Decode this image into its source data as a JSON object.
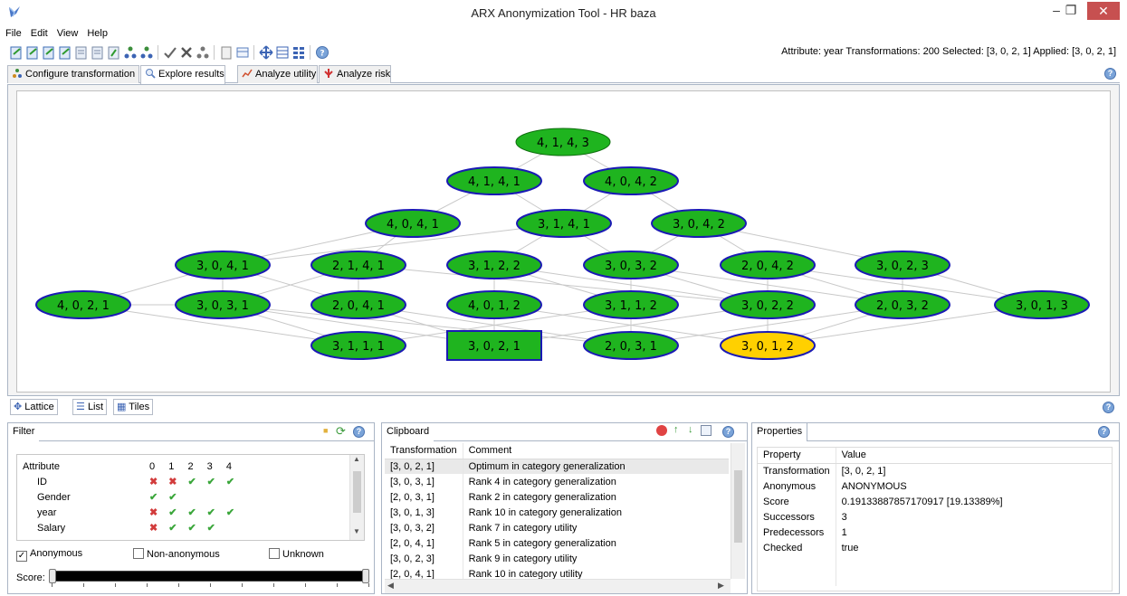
{
  "window": {
    "title": "ARX Anonymization Tool - HR baza",
    "min_label": "–",
    "max_label": "❐",
    "close_label": "✕"
  },
  "menu": [
    "File",
    "Edit",
    "View",
    "Help"
  ],
  "toolbar": {
    "status": "Attribute: year   Transformations: 200   Selected: [3, 0, 2, 1]   Applied: [3, 0, 2, 1]"
  },
  "tabs": [
    {
      "label": "Configure transformation",
      "icon": "configure-icon"
    },
    {
      "label": "Explore results",
      "icon": "magnifier-icon"
    },
    {
      "label": "Analyze utility",
      "icon": "chart-icon"
    },
    {
      "label": "Analyze risk",
      "icon": "risk-icon"
    }
  ],
  "lattice": {
    "colors": {
      "node": "#1fb41f",
      "node_border": "#1a1ab4",
      "applied": "#ffd000",
      "edge": "#c8c8c8"
    },
    "nodes": [
      {
        "label": "4, 1, 4, 3"
      },
      {
        "label": "4, 1, 4, 1"
      },
      {
        "label": "4, 0, 4, 2"
      },
      {
        "label": "4, 0, 4, 1"
      },
      {
        "label": "3, 1, 4, 1"
      },
      {
        "label": "3, 0, 4, 2"
      },
      {
        "label": "3, 0, 4, 1"
      },
      {
        "label": "2, 1, 4, 1"
      },
      {
        "label": "3, 1, 2, 2"
      },
      {
        "label": "3, 0, 3, 2"
      },
      {
        "label": "2, 0, 4, 2"
      },
      {
        "label": "3, 0, 2, 3"
      },
      {
        "label": "4, 0, 2, 1"
      },
      {
        "label": "3, 0, 3, 1"
      },
      {
        "label": "2, 0, 4, 1"
      },
      {
        "label": "4, 0, 1, 2"
      },
      {
        "label": "3, 1, 1, 2"
      },
      {
        "label": "3, 0, 2, 2"
      },
      {
        "label": "2, 0, 3, 2"
      },
      {
        "label": "3, 0, 1, 3"
      },
      {
        "label": "3, 1, 1, 1"
      },
      {
        "label": "3, 0, 2, 1"
      },
      {
        "label": "2, 0, 3, 1"
      },
      {
        "label": "3, 0, 1, 2"
      }
    ]
  },
  "view_tabs": [
    "Lattice",
    "List",
    "Tiles"
  ],
  "filter": {
    "title": "Filter",
    "header": [
      "Attribute",
      "0",
      "1",
      "2",
      "3",
      "4"
    ],
    "rows": [
      {
        "name": "ID",
        "levels": [
          "x",
          "x",
          "v",
          "v",
          "v"
        ]
      },
      {
        "name": "Gender",
        "levels": [
          "v",
          "v",
          "",
          "",
          ""
        ]
      },
      {
        "name": "year",
        "levels": [
          "x",
          "v",
          "v",
          "v",
          "v"
        ]
      },
      {
        "name": "Salary",
        "levels": [
          "x",
          "v",
          "v",
          "v",
          ""
        ]
      }
    ],
    "anonymous": "Anonymous",
    "non_anonymous": "Non-anonymous",
    "unknown": "Unknown",
    "score_label": "Score:"
  },
  "clipboard": {
    "title": "Clipboard",
    "header": [
      "Transformation",
      "Comment"
    ],
    "rows": [
      [
        "[3, 0, 2, 1]",
        "Optimum in category generalization"
      ],
      [
        "[3, 0, 3, 1]",
        "Rank 4 in category generalization"
      ],
      [
        "[2, 0, 3, 1]",
        "Rank 2 in category generalization"
      ],
      [
        "[3, 0, 1, 3]",
        "Rank 10 in category generalization"
      ],
      [
        "[3, 0, 3, 2]",
        "Rank 7 in category utility"
      ],
      [
        "[2, 0, 4, 1]",
        "Rank 5 in category generalization"
      ],
      [
        "[3, 0, 2, 3]",
        "Rank 9 in category utility"
      ],
      [
        "[2, 0, 4, 1]",
        "Rank 10 in category utility"
      ]
    ]
  },
  "properties": {
    "title": "Properties",
    "header": [
      "Property",
      "Value"
    ],
    "rows": [
      [
        "Transformation",
        "[3, 0, 2, 1]"
      ],
      [
        "Anonymous",
        "ANONYMOUS"
      ],
      [
        "Score",
        "0.19133887857170917 [19.13389%]"
      ],
      [
        "Successors",
        "3"
      ],
      [
        "Predecessors",
        "1"
      ],
      [
        "Checked",
        "true"
      ]
    ]
  }
}
